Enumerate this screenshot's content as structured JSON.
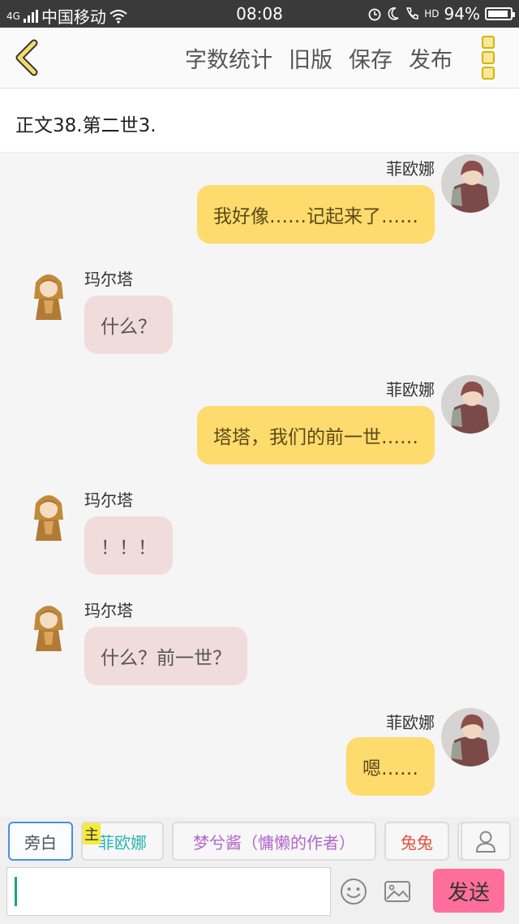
{
  "status_bar": {
    "network": "4G",
    "carrier": "中国移动",
    "time": "08:08",
    "hd": "HD",
    "battery_text": "94%",
    "battery_level": 0.94
  },
  "toolbar": {
    "actions": [
      "字数统计",
      "旧版",
      "保存",
      "发布"
    ]
  },
  "chapter_title": "正文38.第二世3.",
  "messages": [
    {
      "side": "right",
      "name": "菲欧娜",
      "text": "我好像……记起来了……"
    },
    {
      "side": "left",
      "name": "玛尔塔",
      "text": "什么？"
    },
    {
      "side": "right",
      "name": "菲欧娜",
      "text": "塔塔，我们的前一世……"
    },
    {
      "side": "left",
      "name": "玛尔塔",
      "text": "！！！"
    },
    {
      "side": "left",
      "name": "玛尔塔",
      "text": "什么？前一世？"
    },
    {
      "side": "right",
      "name": "菲欧娜",
      "text": "嗯……"
    }
  ],
  "roles": {
    "narrator": "旁白",
    "host_badge": "主",
    "fiona": "菲欧娜",
    "author": "梦兮酱（慵懒的作者）",
    "tutu": "兔兔"
  },
  "input": {
    "value": "",
    "send_label": "发送"
  },
  "colors": {
    "right_bubble": "#fddb6c",
    "left_bubble": "#f1dcdc",
    "send_button": "#ff6f9c",
    "fiona_role": "#2bb5b0",
    "author_role": "#b266cc",
    "tutu_role": "#e0533c",
    "active_border": "#4a8fe0"
  }
}
